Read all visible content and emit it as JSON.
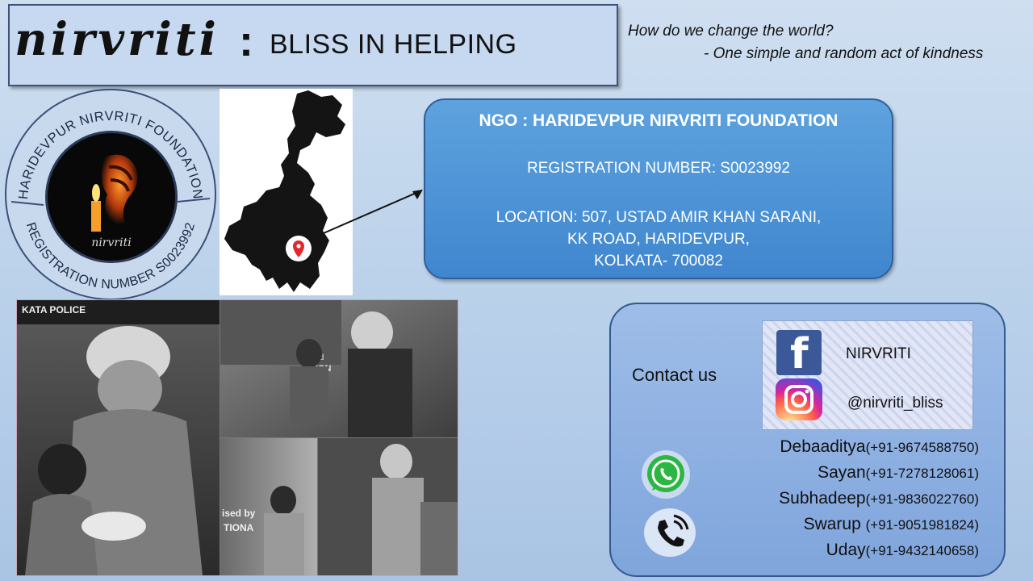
{
  "header": {
    "brand": "nirvriti",
    "separator": ":",
    "tagline": "BLISS IN HELPING"
  },
  "quote": {
    "line1": "How do we change the world?",
    "line2": "- One simple and random act of kindness"
  },
  "logo": {
    "ring_top_text": "HARIDEVPUR NIRVRITI FOUNDATION",
    "ring_bottom_text": "REGISTRATION NUMBER S0023992",
    "inner_text": "nirvriti"
  },
  "map": {
    "icon": "location-pin-icon"
  },
  "ngo": {
    "name": "NGO : HARIDEVPUR NIRVRITI FOUNDATION",
    "registration": "REGISTRATION NUMBER: S0023992",
    "location_lines": [
      "LOCATION: 507, USTAD AMIR KHAN SARANI,",
      "KK ROAD, HARIDEVPUR,",
      "KOLKATA- 700082"
    ]
  },
  "photos": {
    "texts": [
      "KATA POLICE",
      "ised",
      "ATION",
      "ised by",
      "TIONA"
    ]
  },
  "contact": {
    "label": "Contact us",
    "facebook": {
      "icon": "facebook-icon",
      "letter": "f",
      "handle": "NIRVRITI"
    },
    "instagram": {
      "icon": "instagram-icon",
      "handle": "@nirvriti_bliss"
    },
    "people": [
      {
        "name": "Debaaditya",
        "phone": "(+91-9674588750)"
      },
      {
        "name": "Sayan",
        "phone": "(+91-7278128061)"
      },
      {
        "name": "Subhadeep",
        "phone": "(+91-9836022760)"
      },
      {
        "name": "Swarup ",
        "phone": "(+91-9051981824)"
      },
      {
        "name": "Uday",
        "phone": "(+91-9432140658)"
      }
    ],
    "icons": [
      "whatsapp-icon",
      "phone-call-icon"
    ]
  },
  "colors": {
    "banner": "#c6d9f1",
    "info_box": "#4a90d9",
    "contact_box": "#8fb1e2",
    "facebook": "#3b5998"
  }
}
